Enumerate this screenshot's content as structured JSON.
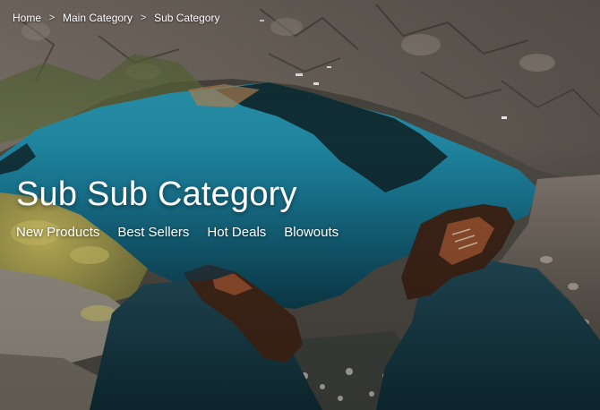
{
  "breadcrumb": {
    "items": [
      "Home",
      "Main Category",
      "Sub Category"
    ],
    "separator": ">"
  },
  "page": {
    "title": "Sub Sub Category"
  },
  "subnav": {
    "links": [
      "New Products",
      "Best Sellers",
      "Hot Deals",
      "Blowouts"
    ]
  },
  "hero": {
    "scene": "mountain-lake-hiker-boots-image",
    "colors": {
      "lake": "#1f7f96",
      "rock": "#7d746a",
      "moss": "#a7a04a",
      "pants": "#163540",
      "boots": "#6b3a22"
    }
  }
}
